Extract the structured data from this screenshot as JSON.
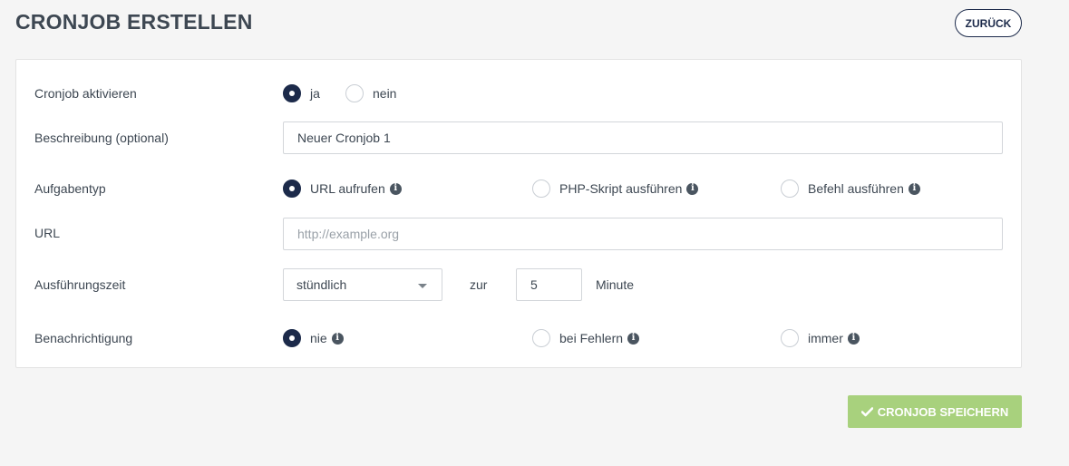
{
  "header": {
    "title": "CRONJOB ERSTELLEN",
    "back_label": "ZURÜCK"
  },
  "form": {
    "activate": {
      "label": "Cronjob aktivieren",
      "options": [
        {
          "label": "ja",
          "checked": true
        },
        {
          "label": "nein",
          "checked": false
        }
      ]
    },
    "description": {
      "label": "Beschreibung (optional)",
      "value": "Neuer Cronjob 1",
      "placeholder": ""
    },
    "task_type": {
      "label": "Aufgabentyp",
      "options": [
        {
          "label": "URL aufrufen",
          "checked": true,
          "info_icon": "info-icon"
        },
        {
          "label": "PHP-Skript ausführen",
          "checked": false,
          "info_icon": "info-icon"
        },
        {
          "label": "Befehl ausführen",
          "checked": false,
          "info_icon": "info-icon"
        }
      ]
    },
    "url": {
      "label": "URL",
      "value": "",
      "placeholder": "http://example.org"
    },
    "schedule": {
      "label": "Ausführungszeit",
      "interval": "stündlich",
      "at_label": "zur",
      "minute": "5",
      "unit_label": "Minute"
    },
    "notification": {
      "label": "Benachrichtigung",
      "options": [
        {
          "label": "nie",
          "checked": true,
          "info_icon": "info-icon"
        },
        {
          "label": "bei Fehlern",
          "checked": false,
          "info_icon": "info-icon"
        },
        {
          "label": "immer",
          "checked": false,
          "info_icon": "info-icon"
        }
      ]
    }
  },
  "actions": {
    "save_label": "CRONJOB SPEICHERN",
    "save_icon": "check-icon"
  },
  "colors": {
    "primary": "#1c2a4a",
    "save_button": "#a8d17d",
    "text": "#3d4752",
    "background": "#f5f5f5"
  }
}
